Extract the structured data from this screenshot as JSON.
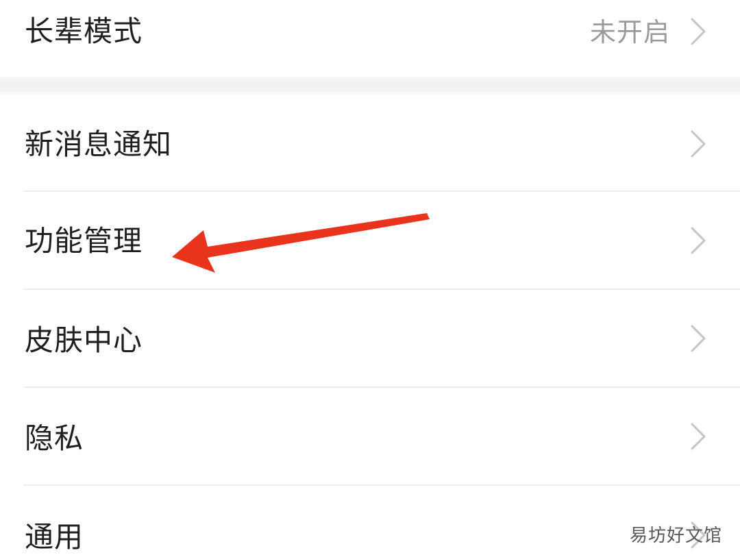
{
  "settings": {
    "items": [
      {
        "label": "长辈模式",
        "value": "未开启"
      },
      {
        "label": "新消息通知"
      },
      {
        "label": "功能管理"
      },
      {
        "label": "皮肤中心"
      },
      {
        "label": "隐私"
      },
      {
        "label": "通用"
      }
    ]
  },
  "annotation": {
    "arrow_color": "#e8341c",
    "points_to": "功能管理"
  },
  "watermark": "易坊好文馆",
  "colors": {
    "text_primary": "#1f1f1f",
    "text_secondary": "#9a9a9a",
    "chevron": "#c4c4c4",
    "divider": "#ededed"
  }
}
